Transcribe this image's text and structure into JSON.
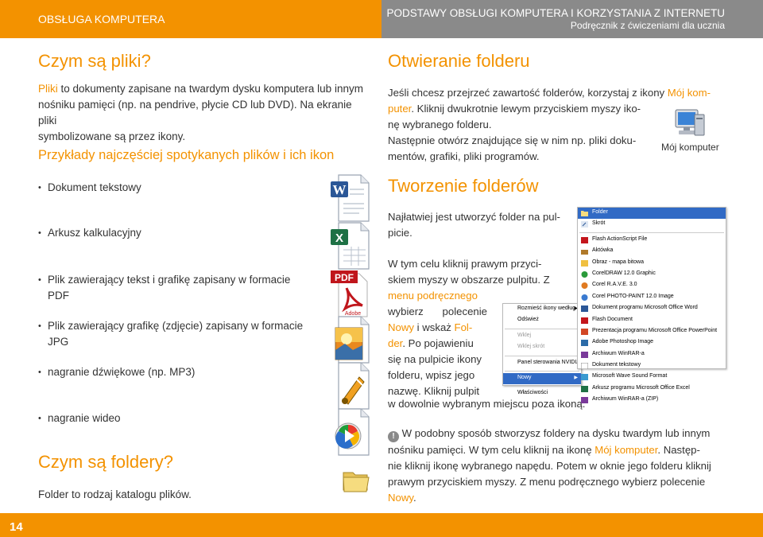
{
  "header": {
    "left_title": "OBSŁUGA KOMPUTERA",
    "right_title": "PODSTAWY OBSŁUGI KOMPUTERA I KORZYSTANIA Z INTERNETU",
    "right_subtitle": "Podręcznik z ćwiczeniami dla ucznia"
  },
  "left": {
    "h_files": "Czym są pliki?",
    "intro_word": "Pliki",
    "intro_rest_1": " to dokumenty zapisane na twardym dysku komputera lub innym",
    "intro_line2": "nośniku pamięci (np. na pendrive, płycie CD lub DVD). Na ekranie pliki",
    "intro_line3": "symbolizowane są przez ikony.",
    "h_examples": "Przykłady najczęściej spotykanych plików i ich ikon",
    "items": [
      {
        "line1": "Dokument tekstowy",
        "line2": "",
        "icon": "word-document-icon"
      },
      {
        "line1": "Arkusz kalkulacyjny",
        "line2": "",
        "icon": "excel-spreadsheet-icon"
      },
      {
        "line1": "Plik zawierający tekst i grafikę zapisany w formacie",
        "line2": "PDF",
        "icon": "pdf-file-icon"
      },
      {
        "line1": "Plik zawierający grafikę (zdjęcie) zapisany w formacie",
        "line2": "JPG",
        "icon": "jpg-image-icon"
      },
      {
        "line1": "nagranie dźwiękowe (np. MP3)",
        "line2": "",
        "icon": "audio-file-icon"
      },
      {
        "line1": "nagranie wideo",
        "line2": "",
        "icon": "video-file-icon"
      }
    ],
    "pdf_icon_label": "PDF",
    "pdf_brand": "Adobe",
    "h_folders": "Czym są foldery?",
    "folder_text": "Folder to rodzaj katalogu plików."
  },
  "right": {
    "h_open": "Otwieranie folderu",
    "open_l1_a": "Jeśli chcesz przejrzeć zawartość folderów, korzystaj z ikony ",
    "open_l1_b": "Mój kom-",
    "open_l2_a": "puter",
    "open_l2_b": ". Kliknij dwukrotnie lewym przyciskiem myszy iko-",
    "open_l3": "nę wybranego folderu.",
    "open_l4": "Następnie otwórz znajdujące się w nim np. pliki doku-",
    "open_l5": "mentów, grafiki, pliki programów.",
    "my_computer_label": "Mój komputer",
    "h_create": "Tworzenie folderów",
    "create_l1": "Najłatwiej jest utworzyć folder na pul-",
    "create_l2": "picie.",
    "create_l3": "W tym celu kliknij prawym przyci-",
    "create_l4": "skiem myszy w obszarze pulpitu. Z",
    "create_l5": "menu podręcznego",
    "create_l6": "wybierz polecenie",
    "create_l7a": "Nowy",
    "create_l7b": " i wskaż ",
    "create_l7c": "Fol-",
    "create_l8a": "der",
    "create_l8b": ". Po pojawieniu",
    "create_l9": "się na pulpicie ikony",
    "create_l10": "folderu, wpisz jego",
    "create_l11": "nazwę. Kliknij pulpit",
    "create_l12": "w dowolnie wybranym miejscu poza ikoną.",
    "tip_mark": "!",
    "tip_l1": " W podobny sposób stworzysz foldery na dysku twardym lub innym",
    "tip_l2a": "nośniku pamięci. W tym celu kliknij na ikonę ",
    "tip_l2b": "Mój komputer",
    "tip_l2c": ". Następ-",
    "tip_l3": "nie kliknij ikonę wybranego napędu. Potem w oknie jego folderu kliknij",
    "tip_l4": "prawym przyciskiem myszy. Z menu podręcznego wybierz polecenie",
    "tip_l5": "Nowy",
    "tip_l5_end": "."
  },
  "context_menu": {
    "items": [
      "Rozmieść ikony według",
      "Odśwież",
      "Wklej",
      "Wklej skrót",
      "Panel sterowania NVIDIA",
      "Nowy",
      "Właściwości"
    ]
  },
  "submenu": {
    "items": [
      "Folder",
      "Skrót",
      "Flash ActionScript File",
      "Aktówka",
      "Obraz - mapa bitowa",
      "CorelDRAW 12.0 Graphic",
      "Corel R.A.V.E. 3.0",
      "Corel PHOTO-PAINT 12.0 Image",
      "Dokument programu Microsoft Office Word",
      "Flash Document",
      "Prezentacja programu Microsoft Office PowerPoint",
      "Adobe Photoshop Image",
      "Archiwum WinRAR-a",
      "Dokument tekstowy",
      "Microsoft Wave Sound Format",
      "Arkusz programu Microsoft Office Excel",
      "Archiwum WinRAR-a (ZIP)"
    ]
  },
  "footer": {
    "page_number": "14"
  },
  "colors": {
    "accent": "#f39200",
    "header_gray": "#8a8a8a",
    "menu_highlight": "#316ac5"
  }
}
